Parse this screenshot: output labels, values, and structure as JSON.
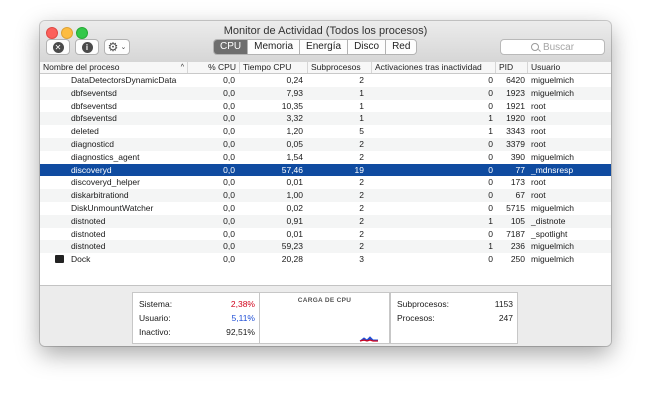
{
  "window": {
    "title": "Monitor de Actividad (Todos los procesos)"
  },
  "toolbar": {
    "tabs": [
      {
        "label": "CPU",
        "active": true
      },
      {
        "label": "Memoria",
        "active": false
      },
      {
        "label": "Energía",
        "active": false
      },
      {
        "label": "Disco",
        "active": false
      },
      {
        "label": "Red",
        "active": false
      }
    ],
    "search_placeholder": "Buscar",
    "info_glyph": "i",
    "close_glyph": "✕",
    "gear_glyph": "⚙",
    "chevron_glyph": "⌄"
  },
  "table": {
    "columns": [
      {
        "key": "name",
        "label": "Nombre del proceso"
      },
      {
        "key": "cpu",
        "label": "% CPU"
      },
      {
        "key": "cpu_time",
        "label": "Tiempo CPU"
      },
      {
        "key": "threads",
        "label": "Subprocesos"
      },
      {
        "key": "wakeups",
        "label": "Activaciones tras inactividad"
      },
      {
        "key": "pid",
        "label": "PID"
      },
      {
        "key": "user",
        "label": "Usuario"
      }
    ],
    "sort_glyph": "^",
    "rows": [
      {
        "name": "DataDetectorsDynamicData",
        "cpu": "0,0",
        "cpu_time": "0,24",
        "threads": "2",
        "wakeups": "0",
        "pid": "6420",
        "user": "miguelmich"
      },
      {
        "name": "dbfseventsd",
        "cpu": "0,0",
        "cpu_time": "7,93",
        "threads": "1",
        "wakeups": "0",
        "pid": "1923",
        "user": "miguelmich"
      },
      {
        "name": "dbfseventsd",
        "cpu": "0,0",
        "cpu_time": "10,35",
        "threads": "1",
        "wakeups": "0",
        "pid": "1921",
        "user": "root"
      },
      {
        "name": "dbfseventsd",
        "cpu": "0,0",
        "cpu_time": "3,32",
        "threads": "1",
        "wakeups": "1",
        "pid": "1920",
        "user": "root"
      },
      {
        "name": "deleted",
        "cpu": "0,0",
        "cpu_time": "1,20",
        "threads": "5",
        "wakeups": "1",
        "pid": "3343",
        "user": "root"
      },
      {
        "name": "diagnosticd",
        "cpu": "0,0",
        "cpu_time": "0,05",
        "threads": "2",
        "wakeups": "0",
        "pid": "3379",
        "user": "root"
      },
      {
        "name": "diagnostics_agent",
        "cpu": "0,0",
        "cpu_time": "1,54",
        "threads": "2",
        "wakeups": "0",
        "pid": "390",
        "user": "miguelmich"
      },
      {
        "name": "discoveryd",
        "cpu": "0,0",
        "cpu_time": "57,46",
        "threads": "19",
        "wakeups": "0",
        "pid": "77",
        "user": "_mdnsresp",
        "selected": true
      },
      {
        "name": "discoveryd_helper",
        "cpu": "0,0",
        "cpu_time": "0,01",
        "threads": "2",
        "wakeups": "0",
        "pid": "173",
        "user": "root"
      },
      {
        "name": "diskarbitrationd",
        "cpu": "0,0",
        "cpu_time": "1,00",
        "threads": "2",
        "wakeups": "0",
        "pid": "67",
        "user": "root"
      },
      {
        "name": "DiskUnmountWatcher",
        "cpu": "0,0",
        "cpu_time": "0,02",
        "threads": "2",
        "wakeups": "0",
        "pid": "5715",
        "user": "miguelmich"
      },
      {
        "name": "distnoted",
        "cpu": "0,0",
        "cpu_time": "0,91",
        "threads": "2",
        "wakeups": "1",
        "pid": "105",
        "user": "_distnote"
      },
      {
        "name": "distnoted",
        "cpu": "0,0",
        "cpu_time": "0,01",
        "threads": "2",
        "wakeups": "0",
        "pid": "7187",
        "user": "_spotlight"
      },
      {
        "name": "distnoted",
        "cpu": "0,0",
        "cpu_time": "59,23",
        "threads": "2",
        "wakeups": "1",
        "pid": "236",
        "user": "miguelmich"
      },
      {
        "name": "Dock",
        "cpu": "0,0",
        "cpu_time": "20,28",
        "threads": "3",
        "wakeups": "0",
        "pid": "250",
        "user": "miguelmich",
        "icon": true
      }
    ]
  },
  "stats": {
    "left": [
      {
        "label": "Sistema:",
        "value": "2,38%",
        "color": "#d0021b"
      },
      {
        "label": "Usuario:",
        "value": "5,11%",
        "color": "#1f4fd6"
      },
      {
        "label": "Inactivo:",
        "value": "92,51%",
        "color": "#1a1a1a"
      }
    ],
    "graph_title": "CARGA DE CPU",
    "right": [
      {
        "label": "Subprocesos:",
        "value": "1153"
      },
      {
        "label": "Procesos:",
        "value": "247"
      }
    ]
  },
  "colors": {
    "selection": "#0f4ba0",
    "system": "#d0021b",
    "user": "#1f4fd6"
  }
}
